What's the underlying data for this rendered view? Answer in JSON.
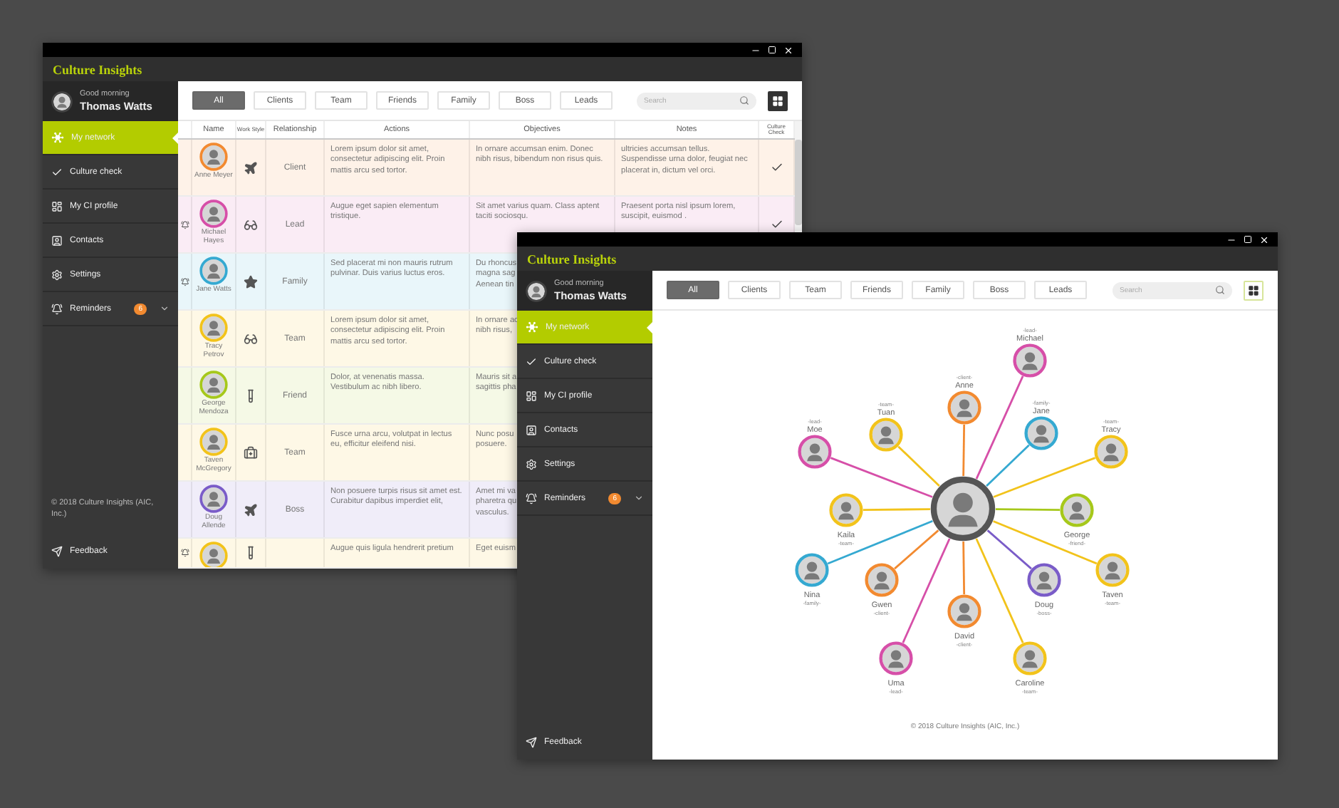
{
  "windows": [
    {
      "kind": "table",
      "title": "Culture Insights",
      "greeting": "Good morning",
      "user_name": "Thomas Watts",
      "nav": [
        {
          "label": "My network",
          "selected": true
        },
        {
          "label": "Culture check",
          "selected": false
        },
        {
          "label": "My CI profile",
          "selected": false
        },
        {
          "label": "Contacts",
          "selected": false
        },
        {
          "label": "Settings",
          "selected": false
        },
        {
          "label": "Reminders",
          "selected": false,
          "badge": "6"
        }
      ],
      "copyright": "© 2018 Culture Insights (AIC, Inc.)",
      "feedback": "Feedback",
      "filters": [
        {
          "label": "All",
          "selected": true
        },
        {
          "label": "Clients",
          "selected": false
        },
        {
          "label": "Team",
          "selected": false
        },
        {
          "label": "Friends",
          "selected": false
        },
        {
          "label": "Family",
          "selected": false
        },
        {
          "label": "Boss",
          "selected": false
        },
        {
          "label": "Leads",
          "selected": false
        }
      ],
      "search": {
        "placeholder": "Search"
      },
      "view_toggle": {
        "selected": true
      },
      "table": {
        "columns": [
          "Name",
          "Work Style",
          "Relationship",
          "Actions",
          "Objectives",
          "Notes",
          "Culture Check"
        ],
        "rows": [
          {
            "name": "Anne Meyer",
            "color": "#f28a30",
            "reminder": false,
            "relationship": "Client",
            "actions": "Lorem ipsum dolor sit amet, consectetur adipiscing elit. Proin mattis arcu sed tortor.",
            "objectives": "In ornare accumsan enim. Donec nibh risus, bibendum non risus quis.",
            "notes": "ultricies accumsan tellus. Suspendisse urna dolor, feugiat nec placerat in, dictum vel orci.",
            "culture_check": true
          },
          {
            "name": "Michael Hayes",
            "color": "#d64fa8",
            "reminder": true,
            "relationship": "Lead",
            "actions": "Augue eget sapien elementum tristique.",
            "objectives": "Sit amet varius quam. Class aptent taciti sociosqu.",
            "notes": "Praesent porta nisl ipsum lorem, suscipit, euismod .",
            "culture_check": true
          },
          {
            "name": "Jane Watts",
            "color": "#35a9d1",
            "reminder": true,
            "relationship": "Family",
            "actions": "Sed placerat mi non mauris rutrum pulvinar. Duis varius luctus eros.",
            "objectives": "Du rhoncus\nmagna sag\nAenean tin"
          },
          {
            "name": "Tracy Petrov",
            "color": "#f2c31b",
            "reminder": false,
            "relationship": "Team",
            "actions": "Lorem ipsum dolor sit amet, consectetur adipiscing elit. Proin mattis arcu sed tortor.",
            "objectives": "In ornare ac\nnibh risus,"
          },
          {
            "name": "George Mendoza",
            "color": "#a6c81b",
            "reminder": false,
            "relationship": "Friend",
            "actions": "Dolor, at venenatis massa. Vestibulum ac nibh libero.",
            "objectives": "Mauris sit a\nsagittis pha"
          },
          {
            "name": "Taven McGregory",
            "color": "#f2c31b",
            "reminder": false,
            "relationship": "Team",
            "actions": "Fusce urna arcu, volutpat in lectus eu, efficitur eleifend nisi.",
            "objectives": "Nunc posu\nposuere."
          },
          {
            "name": "Doug Allende",
            "color": "#7a5cc8",
            "reminder": false,
            "relationship": "Boss",
            "actions": "Non posuere turpis risus sit amet est. Curabitur dapibus imperdiet elit,",
            "objectives": "Amet mi va\npharetra qu\nvasculus."
          },
          {
            "color": "#f2c31b",
            "reminder": true,
            "actions": "Augue quis ligula hendrerit pretium",
            "objectives": "Eget euism"
          }
        ]
      }
    },
    {
      "kind": "network",
      "title": "Culture Insights",
      "greeting": "Good morning",
      "user_name": "Thomas Watts",
      "nav": [
        {
          "label": "My network",
          "selected": true
        },
        {
          "label": "Culture check",
          "selected": false
        },
        {
          "label": "My CI profile",
          "selected": false
        },
        {
          "label": "Contacts",
          "selected": false
        },
        {
          "label": "Settings",
          "selected": false
        },
        {
          "label": "Reminders",
          "selected": false,
          "badge": "6"
        }
      ],
      "feedback": "Feedback",
      "filters": [
        {
          "label": "All",
          "selected": true
        },
        {
          "label": "Clients",
          "selected": false
        },
        {
          "label": "Team",
          "selected": false
        },
        {
          "label": "Friends",
          "selected": false
        },
        {
          "label": "Family",
          "selected": false
        },
        {
          "label": "Boss",
          "selected": false
        },
        {
          "label": "Leads",
          "selected": false
        }
      ],
      "search": {
        "placeholder": "Search"
      },
      "view_toggle": {
        "selected": false
      },
      "network": {
        "nodes": [
          {
            "name": "Michael",
            "relation": "-lead-",
            "color": "#d64fa8"
          },
          {
            "name": "Anne",
            "relation": "-client-",
            "color": "#f28a30"
          },
          {
            "name": "Tuan",
            "relation": "-team-",
            "color": "#f2c31b"
          },
          {
            "name": "Jane",
            "relation": "-family-",
            "color": "#35a9d1"
          },
          {
            "name": "Moe",
            "relation": "-lead-",
            "color": "#d64fa8"
          },
          {
            "name": "Tracy",
            "relation": "-team-",
            "color": "#f2c31b"
          },
          {
            "name": "Kaila",
            "relation": "-team-",
            "color": "#f2c31b"
          },
          {
            "name": "George",
            "relation": "-friend-",
            "color": "#a6c81b"
          },
          {
            "name": "Nina",
            "relation": "-family-",
            "color": "#35a9d1"
          },
          {
            "name": "Gwen",
            "relation": "-client-",
            "color": "#f28a30"
          },
          {
            "name": "Doug",
            "relation": "-boss-",
            "color": "#7a5cc8"
          },
          {
            "name": "Taven",
            "relation": "-team-",
            "color": "#f2c31b"
          },
          {
            "name": "David",
            "relation": "-client-",
            "color": "#f28a30"
          },
          {
            "name": "Uma",
            "relation": "-lead-",
            "color": "#d64fa8"
          },
          {
            "name": "Caroline",
            "relation": "-team-",
            "color": "#f2c31b"
          }
        ]
      },
      "footer": "© 2018 Culture Insights (AIC, Inc.)"
    }
  ]
}
